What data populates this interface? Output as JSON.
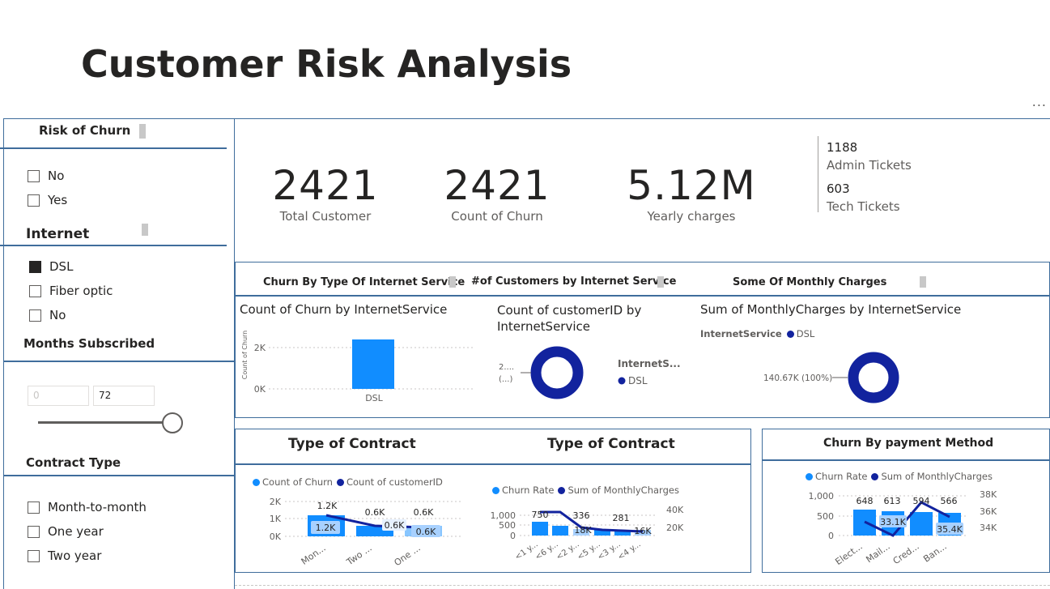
{
  "title": "Customer Risk Analysis",
  "more_options": "...",
  "slicers": {
    "risk": {
      "title": "Risk of Churn",
      "options": [
        {
          "label": "No",
          "checked": false
        },
        {
          "label": "Yes",
          "checked": false
        }
      ]
    },
    "internet": {
      "title": "Internet",
      "options": [
        {
          "label": "DSL",
          "checked": true
        },
        {
          "label": "Fiber optic",
          "checked": false
        },
        {
          "label": "No",
          "checked": false
        }
      ]
    },
    "months": {
      "title": "Months Subscribed",
      "min": "0",
      "max": "72",
      "slider_fraction": 1.0
    },
    "contract": {
      "title": "Contract Type",
      "options": [
        {
          "label": "Month-to-month",
          "checked": false
        },
        {
          "label": "One year",
          "checked": false
        },
        {
          "label": "Two year",
          "checked": false
        }
      ]
    }
  },
  "kpis": [
    {
      "value": "2421",
      "label": "Total Customer"
    },
    {
      "value": "2421",
      "label": "Count of Churn"
    },
    {
      "value": "5.12M",
      "label": "Yearly charges"
    }
  ],
  "tickets": [
    {
      "value": "1188",
      "label": "Admin Tickets"
    },
    {
      "value": "603",
      "label": "Tech Tickets"
    }
  ],
  "tabs": [
    "Churn By Type Of Internet Service",
    "#of Customers by Internet Service",
    "Some Of Monthly Charges"
  ],
  "colors": {
    "primary": "#118dff",
    "navy": "#12239e",
    "light": "#a8d1ff",
    "border": "#3f6d9c"
  },
  "chart_data": [
    {
      "type": "bar",
      "title": "Count of Churn by InternetService",
      "ylabel": "Count of Churn",
      "categories": [
        "DSL"
      ],
      "values": [
        2421
      ],
      "yticks": [
        "2K",
        "0K"
      ],
      "ylim": [
        0,
        3000
      ]
    },
    {
      "type": "pie",
      "title": "Count of customerID by InternetService",
      "legend_title": "InternetS...",
      "legend": [
        "DSL"
      ],
      "slice_label_lines": [
        "2....",
        "(...)"
      ],
      "values": [
        2421
      ]
    },
    {
      "type": "pie",
      "title": "Sum of MonthlyCharges by InternetService",
      "legend_title": "InternetService",
      "legend": [
        "DSL"
      ],
      "slice_label": "140.67K (100%)",
      "values": [
        140670
      ]
    },
    {
      "type": "bar",
      "title": "Type of Contract",
      "series": [
        {
          "name": "Count of Churn"
        },
        {
          "name": "Count of customerID"
        }
      ],
      "categories": [
        "Mon...",
        "Two ...",
        "One ..."
      ],
      "yticks": [
        "2K",
        "1K",
        "0K"
      ],
      "ylim": [
        0,
        2000
      ],
      "bar_values": [
        1200,
        600,
        600
      ],
      "bar_labels": [
        "1.2K",
        "0.6K",
        "0.6K"
      ],
      "line_values": [
        1200,
        600,
        600
      ],
      "line_labels": [
        "1.2K",
        "0.6K",
        "0.6K"
      ]
    },
    {
      "type": "bar",
      "title": "Type of Contract",
      "series": [
        {
          "name": "Churn Rate"
        },
        {
          "name": "Sum of MonthlyCharges"
        }
      ],
      "categories": [
        "<1 y...",
        "<6 y...",
        "<2 y...",
        "<5 y...",
        "<3 y...",
        "<4 y..."
      ],
      "yticks_left": [
        "1,000",
        "500",
        "0"
      ],
      "yticks_right": [
        "40K",
        "20K"
      ],
      "ylim": [
        0,
        1000
      ],
      "bar_values": [
        750,
        650,
        336,
        336,
        281,
        281
      ],
      "bar_labels": [
        "750",
        "336",
        "281"
      ],
      "line_values": [
        32000,
        32000,
        18000,
        17000,
        16500,
        16000
      ],
      "line_labels": [
        "18K",
        "16K"
      ]
    },
    {
      "type": "bar",
      "title": "Churn By payment Method",
      "series": [
        {
          "name": "Churn Rate"
        },
        {
          "name": "Sum of MonthlyCharges"
        }
      ],
      "categories": [
        "Elect...",
        "Mail...",
        "Cred...",
        "Ban..."
      ],
      "yticks_left": [
        "1,000",
        "500",
        "0"
      ],
      "yticks_right": [
        "38K",
        "36K",
        "34K"
      ],
      "ylim": [
        0,
        1000
      ],
      "bar_values": [
        648,
        613,
        594,
        566
      ],
      "bar_labels": [
        "648",
        "613",
        "594",
        "566"
      ],
      "line_values": [
        34000,
        33100,
        37000,
        35400
      ],
      "line_labels": [
        "33.1K",
        "35.4K"
      ]
    }
  ]
}
